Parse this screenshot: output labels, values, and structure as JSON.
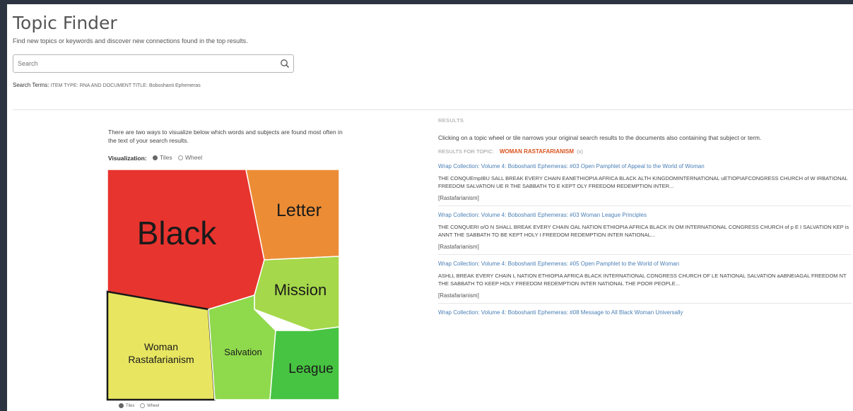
{
  "page": {
    "title": "Topic Finder",
    "subtitle": "Find new topics or keywords and discover new connections found in the top results."
  },
  "search": {
    "placeholder": "Search",
    "icon": "search-icon"
  },
  "search_terms": {
    "label": "Search Terms:",
    "term1_key": "ITEM TYPE:",
    "term1_value": "RNA AND",
    "term2_key": "DOCUMENT TITLE:",
    "term2_value": "Boboshanti Ephemeras"
  },
  "visualization": {
    "description": "There are two ways to visualize below which words and subjects are found most often in the text of your search results.",
    "label": "Visualization:",
    "options": [
      "Tiles",
      "Wheel"
    ],
    "selected": "Tiles",
    "tiles": [
      {
        "label": "Black",
        "color": "#e8342f",
        "weight": 30
      },
      {
        "label": "Letter",
        "color": "#ec8d36",
        "weight": 12
      },
      {
        "label": "Mission",
        "color": "#a5d84a",
        "weight": 12
      },
      {
        "label": "Woman Rastafarianism",
        "color": "#e8e660",
        "weight": 18,
        "selected": true
      },
      {
        "label": "Salvation",
        "color": "#8fd94d",
        "weight": 9
      },
      {
        "label": "League",
        "color": "#47c442",
        "weight": 9
      }
    ],
    "bottom_options": [
      "Tiles",
      "Wheel"
    ]
  },
  "results": {
    "header": "RESULTS",
    "intro": "Clicking on a topic wheel or tile narrows your original search results to the documents also containing that subject or term.",
    "topic_label": "RESULTS FOR TOPIC:",
    "topic_value": "WOMAN RASTAFARIANISM",
    "topic_remove": "(x)",
    "items": [
      {
        "title": "Wrap Collection: Volume 4: Boboshanti Ephemeras: #03 Open Pamphlet of Appeal to the World of Woman",
        "snippet": "THE CONQUEmpIBU SALL BREAK EVERY CHAIN EANETHIOPIA AFRICA BLACK ALTH KINGDOMINTERNATIONAL uETIOPIAFCONGRESS CHURCH of W IRBATIONAL FREEDOM SALVATION UE R THE SABBATH TO E KEPT OLY FREEDOM REDEMPTION INTER...",
        "tag": "[Rastafarianism]"
      },
      {
        "title": "Wrap Collection: Volume 4: Boboshanti Ephemeras: #03 Woman League Principles",
        "snippet": "THE CONQUERI o/O N SHALL BREAK EVERY CHAIN OAL NATION ETHIOPIA AFRICA BLACK IN OM INTERNATIONAL CONGRESS CHURCH of p E I SALVATION KEP is ANNT THE SABBATH TO BE KEPT HOLY I FREEDOM REDEMPTION INTER NATIONAL...",
        "tag": "[Rastafarianism]"
      },
      {
        "title": "Wrap Collection: Volume 4: Boboshanti Ephemeras: #05 Open Pamphlet to the World of Woman",
        "snippet": "ASHLL BREAK EVERY CHAIN L NATION ETHIOPIA AFRICA BLACK INTERNATIONAL CONGRESS CHURCH OF LE NATIONAL SALVATION aABNEIAGAL FREEDOM NT THE SABBATH TO KEEP HOLY FREEDOM REDEMPTION INTER NATIONAL THE POOR PEOPLE...",
        "tag": "[Rastafarianism]"
      },
      {
        "title": "Wrap Collection: Volume 4: Boboshanti Ephemeras: #08 Message to All Black Woman Universally",
        "snippet": "",
        "tag": ""
      }
    ]
  }
}
